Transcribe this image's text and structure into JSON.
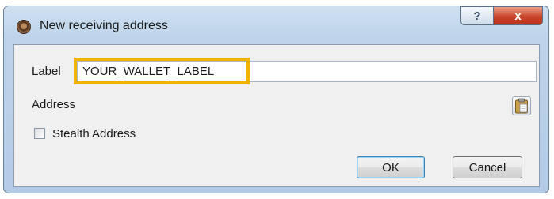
{
  "window": {
    "title": "New receiving address",
    "help_button": "?",
    "close_button": "x"
  },
  "form": {
    "label_caption": "Label",
    "label_value": "YOUR_WALLET_LABEL",
    "address_caption": "Address",
    "stealth_label": "Stealth Address",
    "stealth_checked": false
  },
  "buttons": {
    "ok": "OK",
    "cancel": "Cancel"
  },
  "icons": {
    "app": "coin-icon",
    "paste": "clipboard-paste-icon"
  },
  "colors": {
    "highlight": "#f0b400",
    "close_button": "#c9442a"
  }
}
